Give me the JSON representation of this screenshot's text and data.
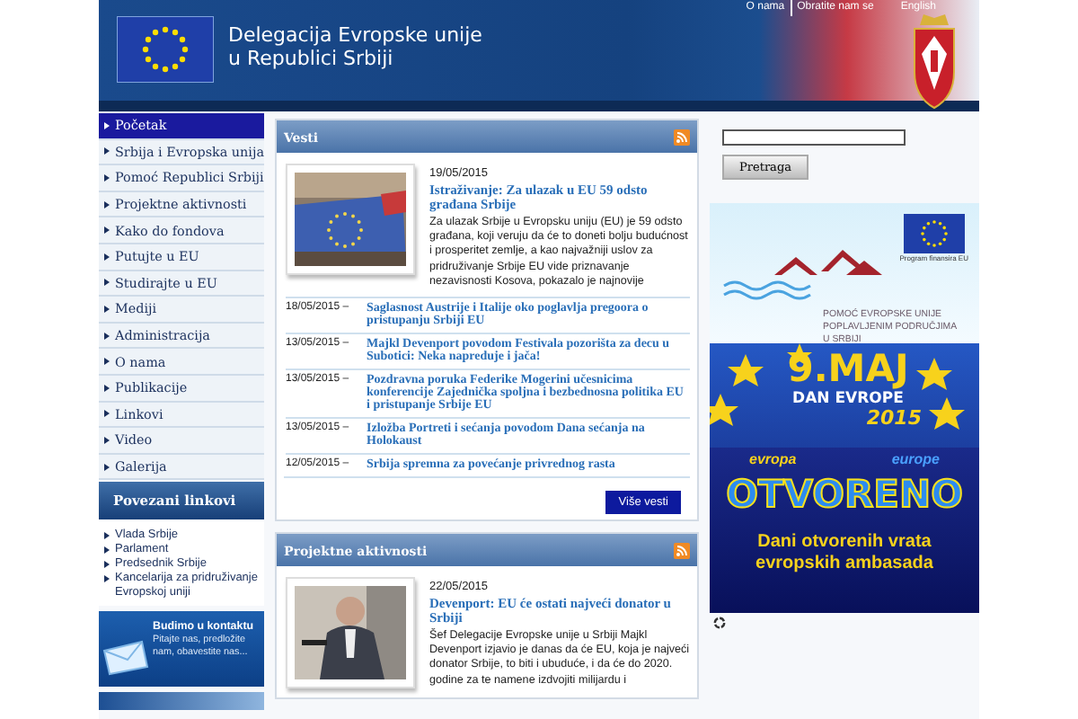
{
  "header": {
    "title_lines": [
      "Delegacija Evropske unije",
      "u Republici Srbiji"
    ],
    "top_links": [
      "O nama",
      "Obratite nam se",
      "English"
    ]
  },
  "nav": {
    "items": [
      {
        "label": "Početak",
        "selected": true
      },
      {
        "label": "Srbija i Evropska unija",
        "selected": false
      },
      {
        "label": "Pomoć Republici Srbiji",
        "selected": false
      },
      {
        "label": "Projektne aktivnosti",
        "selected": false
      },
      {
        "label": "Kako do fondova",
        "selected": false
      },
      {
        "label": "Putujte u EU",
        "selected": false
      },
      {
        "label": "Studirajte u EU",
        "selected": false
      },
      {
        "label": "Mediji",
        "selected": false
      },
      {
        "label": "Administracija",
        "selected": false
      },
      {
        "label": "O nama",
        "selected": false
      },
      {
        "label": "Publikacije",
        "selected": false
      },
      {
        "label": "Linkovi",
        "selected": false
      },
      {
        "label": "Video",
        "selected": false
      },
      {
        "label": "Galerija",
        "selected": false
      }
    ]
  },
  "related_links": {
    "title": "Povezani linkovi",
    "items": [
      "Vlada Srbije",
      "Parlament",
      "Predsednik Srbije",
      "Kancelarija za pridruživanje Evropskoj uniji"
    ]
  },
  "contact": {
    "title": "Budimo u kontaktu",
    "text": "Pitajte nas, predložite nam, obavestite nas..."
  },
  "news": {
    "title": "Vesti",
    "featured": {
      "date": "19/05/2015",
      "title": "Istraživanje: Za ulazak u EU 59 odsto građana Srbije",
      "text": "Za ulazak Srbije u Evropsku uniju (EU) je 59 odsto građana, koji veruju da će to doneti bolju budućnost i prosperitet zemlje, a kao najvažniji uslov za pridruživanje Srbije EU vide priznavanje nezavisnosti Kosova, pokazalo je najnovije"
    },
    "items": [
      {
        "date": "18/05/2015 –",
        "title": "Saglasnost Austrije i Italije oko poglavlja pregoora o pristupanju Srbiji EU"
      },
      {
        "date": "13/05/2015 –",
        "title": "Majkl Devenport povodom Festivala pozorišta za decu u Subotici: Neka napreduje i jača!"
      },
      {
        "date": "13/05/2015 –",
        "title": "Pozdravna poruka Federike Mogerini učesnicima konferencije Zajednička spoljna i bezbednosna politika EU i pristupanje Srbije EU"
      },
      {
        "date": "13/05/2015 –",
        "title": "Izložba Portreti i sećanja povodom Dana sećanja na Holokaust"
      },
      {
        "date": "12/05/2015 –",
        "title": "Srbija spremna za povećanje privrednog rasta"
      }
    ],
    "more_button": "Više vesti"
  },
  "projects": {
    "title": "Projektne aktivnosti",
    "featured": {
      "date": "22/05/2015",
      "title": "Devenport: EU će ostati najveći donator u Srbiji",
      "text": "Šef Delegacije Evropske unije u Srbiji Majkl Devenport izjavio je danas da će EU, koja je najveći donator Srbije, to biti i ubuduće, i da će do 2020. godine za te namene izdvojiti milijardu i"
    }
  },
  "search": {
    "button": "Pretraga"
  },
  "banners": [
    {
      "kind": "flood",
      "lines": [
        "POMOĆ EVROPSKE UNIJE",
        "POPLAVLJENIM PODRUČJIMA",
        "U SRBIJI"
      ],
      "note": "Program finansira EU"
    },
    {
      "kind": "europe_day",
      "lines": [
        "9.MAJ",
        "DAN EVROPE",
        "2015"
      ]
    },
    {
      "kind": "open_doors",
      "lines": [
        "evropa",
        "europe",
        "OTVORENO",
        "Dani otvorenih vrata evropskih ambasada"
      ]
    }
  ]
}
